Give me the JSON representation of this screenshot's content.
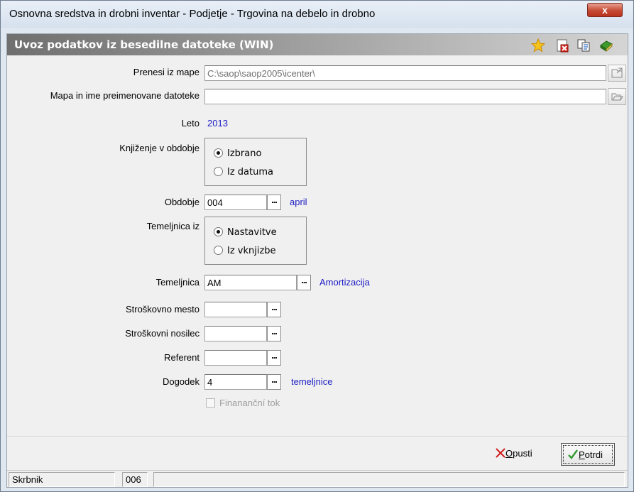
{
  "window": {
    "title": "Osnovna sredstva in drobni inventar  - Podjetje - Trgovina na debelo in drobno",
    "close_label": "x"
  },
  "header": {
    "title": "Uvoz podatkov iz besedilne datoteke (WIN)",
    "icons": [
      "star-icon",
      "delete-doc-icon",
      "copy-icon",
      "help-book-icon"
    ]
  },
  "form": {
    "prenesi_label": "Prenesi iz mape",
    "prenesi_value": "C:\\saop\\saop2005\\icenter\\",
    "mapa_label": "Mapa in ime preimenovane datoteke",
    "mapa_value": "",
    "leto_label": "Leto",
    "leto_value": "2013",
    "knjizenje_label": "Knjiženje v obdobje",
    "knjizenje_opt1": "Izbrano",
    "knjizenje_opt2": "Iz datuma",
    "obdobje_label": "Obdobje",
    "obdobje_value": "004",
    "obdobje_desc": "april",
    "temeljnica_iz_label": "Temeljnica iz",
    "temeljnica_iz_opt1": "Nastavitve",
    "temeljnica_iz_opt2": "Iz vknjizbe",
    "temeljnica_label": "Temeljnica",
    "temeljnica_value": "AM",
    "temeljnica_desc": "Amortizacija",
    "strosk_mesto_label": "Stroškovno mesto",
    "strosk_mesto_value": "",
    "strosk_nosilec_label": "Stroškovni nosilec",
    "strosk_nosilec_value": "",
    "referent_label": "Referent",
    "referent_value": "",
    "dogodek_label": "Dogodek",
    "dogodek_value": "4",
    "dogodek_desc": "temeljnice",
    "financni_tok_label": "Finananční tok",
    "dots": "..."
  },
  "buttons": {
    "opusti_pre": "",
    "opusti_u": "O",
    "opusti_post": "pusti",
    "potrdi_u": "P",
    "potrdi_post": "otrdi"
  },
  "status": {
    "user": "Skrbnik",
    "code": "006",
    "extra": ""
  },
  "colors": {
    "value_text": "#1c1cc4",
    "header_bg": "#6f6f6f",
    "close_red": "#c64a34"
  }
}
